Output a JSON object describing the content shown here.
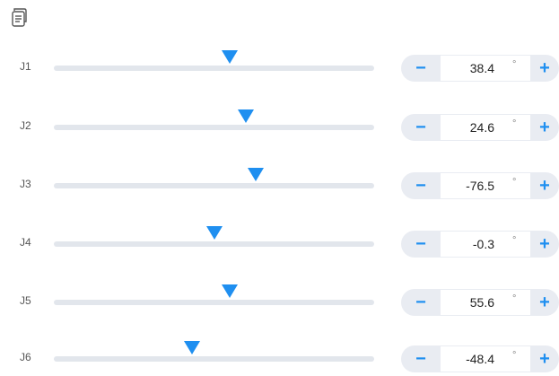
{
  "toolbar": {
    "copy_icon": "copy-document-icon"
  },
  "colors": {
    "accent": "#1f8ff0",
    "track": "#e2e6ec",
    "stepper_bg": "#e9ecf2"
  },
  "joints": [
    {
      "label": "J1",
      "value": "38.4",
      "unit": "°",
      "minus": "−",
      "plus": "+",
      "slider_fraction": 0.55
    },
    {
      "label": "J2",
      "value": "24.6",
      "unit": "°",
      "minus": "−",
      "plus": "+",
      "slider_fraction": 0.6
    },
    {
      "label": "J3",
      "value": "-76.5",
      "unit": "°",
      "minus": "−",
      "plus": "+",
      "slider_fraction": 0.63
    },
    {
      "label": "J4",
      "value": "-0.3",
      "unit": "°",
      "minus": "−",
      "plus": "+",
      "slider_fraction": 0.5
    },
    {
      "label": "J5",
      "value": "55.6",
      "unit": "°",
      "minus": "−",
      "plus": "+",
      "slider_fraction": 0.55
    },
    {
      "label": "J6",
      "value": "-48.4",
      "unit": "°",
      "minus": "−",
      "plus": "+",
      "slider_fraction": 0.43
    }
  ]
}
